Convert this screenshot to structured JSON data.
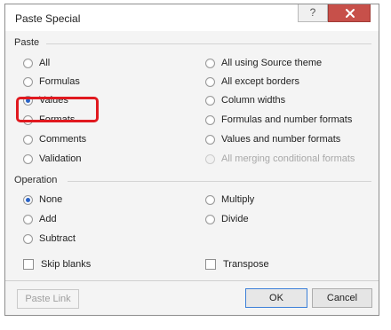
{
  "dialog": {
    "title": "Paste Special",
    "help_label": "?",
    "close_icon": "x-icon",
    "close_color": "#c7504a"
  },
  "paste": {
    "label": "Paste",
    "options_left": [
      {
        "label": "All",
        "checked": false
      },
      {
        "label": "Formulas",
        "checked": false
      },
      {
        "label": "Values",
        "checked": true
      },
      {
        "label": "Formats",
        "checked": false
      },
      {
        "label": "Comments",
        "checked": false
      },
      {
        "label": "Validation",
        "checked": false
      }
    ],
    "options_right": [
      {
        "label": "All using Source theme",
        "checked": false,
        "disabled": false
      },
      {
        "label": "All except borders",
        "checked": false,
        "disabled": false
      },
      {
        "label": "Column widths",
        "checked": false,
        "disabled": false
      },
      {
        "label": "Formulas and number formats",
        "checked": false,
        "disabled": false
      },
      {
        "label": "Values and number formats",
        "checked": false,
        "disabled": false
      },
      {
        "label": "All merging conditional formats",
        "checked": false,
        "disabled": true
      }
    ]
  },
  "operation": {
    "label": "Operation",
    "options_left": [
      {
        "label": "None",
        "checked": true
      },
      {
        "label": "Add",
        "checked": false
      },
      {
        "label": "Subtract",
        "checked": false
      }
    ],
    "options_right": [
      {
        "label": "Multiply",
        "checked": false
      },
      {
        "label": "Divide",
        "checked": false
      }
    ]
  },
  "checkboxes": {
    "skip_blanks": "Skip blanks",
    "transpose": "Transpose"
  },
  "buttons": {
    "paste_link": "Paste Link",
    "ok": "OK",
    "cancel": "Cancel"
  },
  "highlight_color": "#e0191f"
}
